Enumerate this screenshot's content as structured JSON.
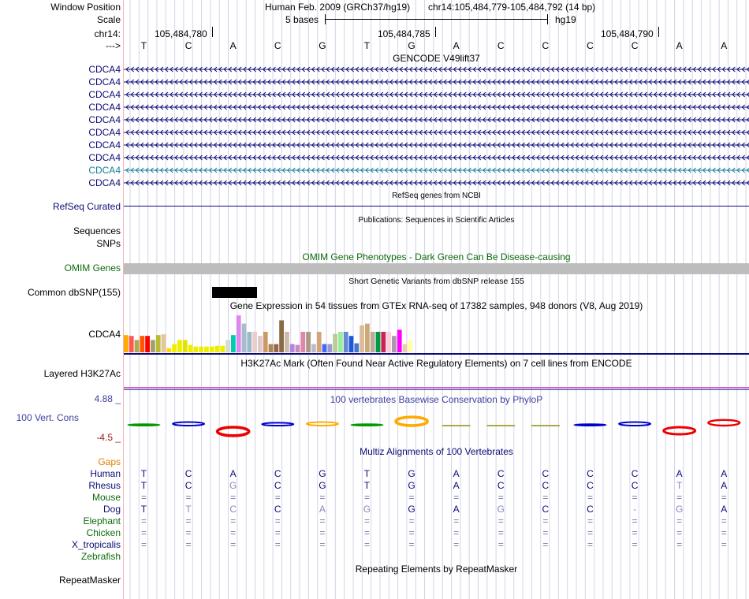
{
  "header": {
    "window_position_label": "Window Position",
    "assembly_text": "Human Feb. 2009 (GRCh37/hg19)",
    "position_text": "chr14:105,484,779-105,484,792 (14 bp)",
    "scale_label": "Scale",
    "scale_text": "5 bases",
    "db_text": "hg19",
    "chrom_label": "chr14:",
    "ruler_ticks": [
      "105,484,780",
      "105,484,785",
      "105,484,790"
    ],
    "strand_label": "--->"
  },
  "bases": [
    "T",
    "C",
    "A",
    "C",
    "G",
    "T",
    "G",
    "A",
    "C",
    "C",
    "C",
    "C",
    "A",
    "A"
  ],
  "gencode": {
    "title": "GENCODE V49lift37",
    "transcripts": [
      "CDCA4",
      "CDCA4",
      "CDCA4",
      "CDCA4",
      "CDCA4",
      "CDCA4",
      "CDCA4",
      "CDCA4",
      "CDCA4",
      "CDCA4"
    ],
    "colors": [
      "#0c0c78",
      "#0c0c78",
      "#0c0c78",
      "#0c0c78",
      "#0c0c78",
      "#0c0c78",
      "#0c0c78",
      "#0c0c78",
      "#147f9c",
      "#0c0c78"
    ]
  },
  "refseq": {
    "title": "RefSeq genes from NCBI",
    "label": "RefSeq Curated",
    "color": "#0c0c78"
  },
  "publications": {
    "title": "Publications: Sequences in Scientific Articles",
    "labels": [
      "Sequences",
      "SNPs"
    ]
  },
  "omim": {
    "title": "OMIM Gene Phenotypes - Dark Green Can Be Disease-causing",
    "label": "OMIM Genes",
    "color": "#0a6b0a"
  },
  "dbsnp": {
    "title": "Short Genetic Variants from dbSNP release 155",
    "label": "Common dbSNP(155)"
  },
  "gtex": {
    "title": "Gene Expression in 54 tissues from GTEx RNA-seq of 17382 samples, 948 donors (V8, Aug 2019)",
    "label": "CDCA4",
    "bars": [
      0.42,
      0.4,
      0.3,
      0.4,
      0.4,
      0.3,
      0.42,
      0.44,
      0.1,
      0.2,
      0.3,
      0.3,
      0.18,
      0.14,
      0.14,
      0.14,
      0.14,
      0.16,
      0.16,
      0.3,
      0.42,
      0.9,
      0.7,
      0.5,
      0.5,
      0.4,
      0.5,
      0.2,
      0.2,
      0.78,
      0.5,
      0.2,
      0.18,
      0.5,
      0.5,
      0.2,
      0.5,
      0.2,
      0.2,
      0.45,
      0.5,
      0.5,
      0.4,
      0.22,
      0.66,
      0.7,
      0.5,
      0.5,
      0.5,
      0.5,
      0.4,
      0.55,
      0.2,
      0.3
    ],
    "colors": [
      "#ffaa00",
      "#ff5555",
      "#aaaa55",
      "#ff5500",
      "#ff0000",
      "#a0a06a",
      "#bbbb33",
      "#e2c79b",
      "#ffd700",
      "#eeee00",
      "#eeee00",
      "#e2e200",
      "#eeee00",
      "#eeee00",
      "#eeee00",
      "#eeee00",
      "#eeee00",
      "#eeee00",
      "#eeee00",
      "#d9d9d9",
      "#00ccb0",
      "#dd88ee",
      "#aabbcc",
      "#99bbcc",
      "#eecccc",
      "#ddcccc",
      "#cc9966",
      "#aa8855",
      "#996644",
      "#8b6b45",
      "#ccbbaa",
      "#aa88dd",
      "#cc88bb",
      "#dd88aa",
      "#aa9988",
      "#bbbbcc",
      "#d2a679",
      "#4466ff",
      "#9999cc",
      "#bbcc99",
      "#99ee99",
      "#6688cc",
      "#2255dd",
      "#4477cc",
      "#ddbb99",
      "#ccaa77",
      "#bbaa99",
      "#009944",
      "#cc2255",
      "#ffccdd",
      "#aa99aa",
      "#ff00ff",
      "#eeccaa",
      "#ffffaa"
    ]
  },
  "h3k27ac": {
    "title": "H3K27Ac Mark (Often Found Near Active Regulatory Elements) on 7 cell lines from ENCODE",
    "label": "Layered H3K27Ac"
  },
  "phylop": {
    "title": "100 vertebrates Basewise Conservation by PhyloP",
    "label": "100 Vert. Cons",
    "ymax": "4.88 _",
    "ymin": "-4.5 _",
    "scores": [
      0.1,
      0.25,
      -0.6,
      0.2,
      0.25,
      0.1,
      0.6,
      0,
      0.05,
      0.05,
      0.1,
      0.25,
      -0.5,
      0.4
    ]
  },
  "multiz": {
    "title": "Multiz Alignments of 100 Vertebrates",
    "gaps_label": "Gaps",
    "species": [
      {
        "name": "Human",
        "bases": [
          "T",
          "C",
          "A",
          "C",
          "G",
          "T",
          "G",
          "A",
          "C",
          "C",
          "C",
          "C",
          "A",
          "A"
        ]
      },
      {
        "name": "Rhesus",
        "bases": [
          "T",
          "C",
          "G",
          "C",
          "G",
          "T",
          "G",
          "A",
          "C",
          "C",
          "C",
          "C",
          "T",
          "A"
        ]
      },
      {
        "name": "Mouse",
        "bases": [
          "=",
          "=",
          "=",
          "=",
          "=",
          "=",
          "=",
          "=",
          "=",
          "=",
          "=",
          "=",
          "=",
          "="
        ]
      },
      {
        "name": "Dog",
        "bases": [
          "T",
          "T",
          "C",
          "C",
          "A",
          "G",
          "G",
          "A",
          "G",
          "C",
          "C",
          "-",
          "G",
          "A"
        ]
      },
      {
        "name": "Elephant",
        "bases": [
          "=",
          "=",
          "=",
          "=",
          "=",
          "=",
          "=",
          "=",
          "=",
          "=",
          "=",
          "=",
          "=",
          "="
        ]
      },
      {
        "name": "Chicken",
        "bases": [
          "=",
          "=",
          "=",
          "=",
          "=",
          "=",
          "=",
          "=",
          "=",
          "=",
          "=",
          "=",
          "=",
          "="
        ]
      },
      {
        "name": "X_tropicalis",
        "bases": [
          "=",
          "=",
          "=",
          "=",
          "=",
          "=",
          "=",
          "=",
          "=",
          "=",
          "=",
          "=",
          "=",
          "="
        ]
      },
      {
        "name": "Zebrafish",
        "bases": [
          "",
          "",
          "",
          "",
          "",
          "",
          "",
          "",
          "",
          "",
          "",
          "",
          "",
          ""
        ]
      }
    ]
  },
  "repeatmasker": {
    "title": "Repeating Elements by RepeatMasker",
    "label": "RepeatMasker"
  },
  "colors": {
    "label_blue": "#0c0c78",
    "green": "#0a6b0a",
    "orange": "#e08000",
    "phylop_blue": "#3f3f9f",
    "phylop_red": "#a02020",
    "h3k_purple": "#cc66cc"
  }
}
